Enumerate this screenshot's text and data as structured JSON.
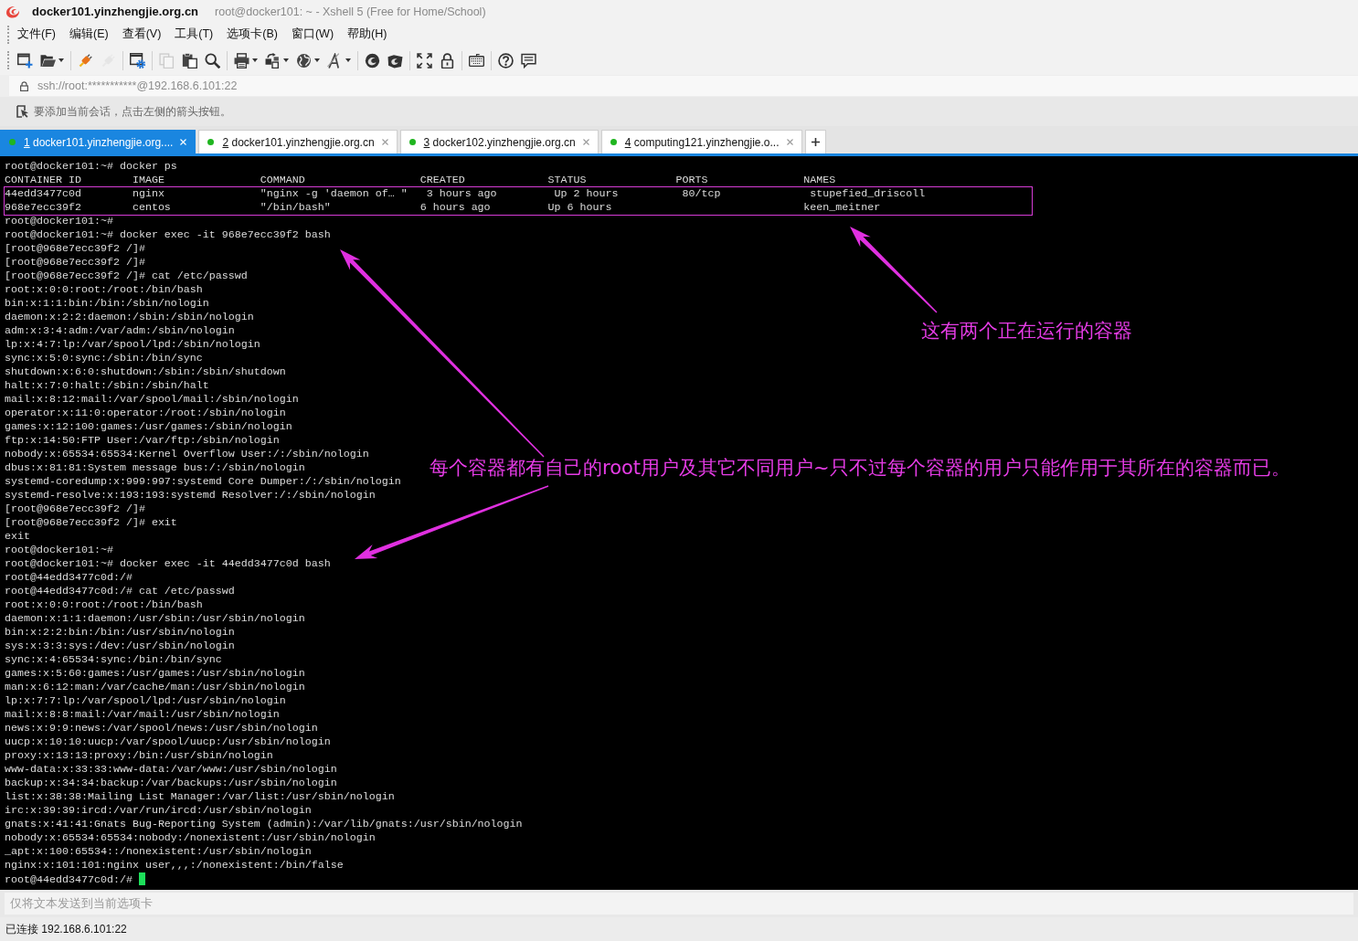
{
  "window": {
    "title": "docker101.yinzhengjie.org.cn",
    "subtitle": "root@docker101: ~ - Xshell 5 (Free for Home/School)"
  },
  "menu": [
    "文件(F)",
    "编辑(E)",
    "查看(V)",
    "工具(T)",
    "选项卡(B)",
    "窗口(W)",
    "帮助(H)"
  ],
  "toolbar": {
    "groups": [
      {
        "buttons": [
          {
            "disabled": false,
            "dropdown": false
          },
          {
            "disabled": false,
            "dropdown": true
          }
        ]
      },
      {
        "buttons": [
          {
            "disabled": false,
            "dropdown": false
          },
          {
            "disabled": true,
            "dropdown": false
          }
        ]
      },
      {
        "buttons": [
          {
            "disabled": false,
            "dropdown": false
          }
        ]
      },
      {
        "buttons": [
          {
            "disabled": true,
            "dropdown": false
          },
          {
            "disabled": false,
            "dropdown": false
          },
          {
            "disabled": false,
            "dropdown": false
          }
        ]
      },
      {
        "buttons": [
          {
            "disabled": false,
            "dropdown": true
          },
          {
            "disabled": false,
            "dropdown": true
          },
          {
            "disabled": false,
            "dropdown": true
          },
          {
            "disabled": false,
            "dropdown": true
          }
        ]
      },
      {
        "buttons": [
          {
            "disabled": false,
            "dropdown": false
          },
          {
            "disabled": false,
            "dropdown": false
          }
        ]
      },
      {
        "buttons": [
          {
            "disabled": false,
            "dropdown": false
          },
          {
            "disabled": false,
            "dropdown": false
          }
        ]
      },
      {
        "buttons": [
          {
            "disabled": false,
            "dropdown": false
          }
        ]
      },
      {
        "buttons": [
          {
            "disabled": false,
            "dropdown": false
          },
          {
            "disabled": false,
            "dropdown": false
          }
        ]
      }
    ]
  },
  "address_bar": {
    "value": "ssh://root:***********@192.168.6.101:22"
  },
  "hint": "要添加当前会话，点击左侧的箭头按钮。",
  "tabs": [
    {
      "number": "1",
      "label": "docker101.yinzhengjie.org....",
      "selected": true,
      "connected": true
    },
    {
      "number": "2",
      "label": "docker101.yinzhengjie.org.cn",
      "selected": false,
      "connected": true
    },
    {
      "number": "3",
      "label": "docker102.yinzhengjie.org.cn",
      "selected": false,
      "connected": true
    },
    {
      "number": "4",
      "label": "computing121.yinzhengjie.o...",
      "selected": false,
      "connected": true
    }
  ],
  "terminal": {
    "blocks": [
      {
        "kind": "text",
        "lines": [
          "root@docker101:~# docker ps",
          "CONTAINER ID        IMAGE               COMMAND                  CREATED             STATUS              PORTS               NAMES"
        ]
      },
      {
        "kind": "boxed",
        "lines": [
          "44edd3477c0d        nginx               \"nginx -g 'daemon of… \"   3 hours ago         Up 2 hours          80/tcp              stupefied_driscoll",
          "968e7ecc39f2        centos              \"/bin/bash\"              6 hours ago         Up 6 hours                              keen_meitner"
        ]
      },
      {
        "kind": "text",
        "lines": [
          "root@docker101:~#",
          "root@docker101:~# docker exec -it 968e7ecc39f2 bash",
          "[root@968e7ecc39f2 /]#",
          "[root@968e7ecc39f2 /]#",
          "[root@968e7ecc39f2 /]# cat /etc/passwd",
          "root:x:0:0:root:/root:/bin/bash",
          "bin:x:1:1:bin:/bin:/sbin/nologin",
          "daemon:x:2:2:daemon:/sbin:/sbin/nologin",
          "adm:x:3:4:adm:/var/adm:/sbin/nologin",
          "lp:x:4:7:lp:/var/spool/lpd:/sbin/nologin",
          "sync:x:5:0:sync:/sbin:/bin/sync",
          "shutdown:x:6:0:shutdown:/sbin:/sbin/shutdown",
          "halt:x:7:0:halt:/sbin:/sbin/halt",
          "mail:x:8:12:mail:/var/spool/mail:/sbin/nologin",
          "operator:x:11:0:operator:/root:/sbin/nologin",
          "games:x:12:100:games:/usr/games:/sbin/nologin",
          "ftp:x:14:50:FTP User:/var/ftp:/sbin/nologin",
          "nobody:x:65534:65534:Kernel Overflow User:/:/sbin/nologin",
          "dbus:x:81:81:System message bus:/:/sbin/nologin",
          "systemd-coredump:x:999:997:systemd Core Dumper:/:/sbin/nologin",
          "systemd-resolve:x:193:193:systemd Resolver:/:/sbin/nologin",
          "[root@968e7ecc39f2 /]#",
          "[root@968e7ecc39f2 /]# exit",
          "exit",
          "root@docker101:~#",
          "root@docker101:~# docker exec -it 44edd3477c0d bash",
          "root@44edd3477c0d:/#",
          "root@44edd3477c0d:/# cat /etc/passwd",
          "root:x:0:0:root:/root:/bin/bash",
          "daemon:x:1:1:daemon:/usr/sbin:/usr/sbin/nologin",
          "bin:x:2:2:bin:/bin:/usr/sbin/nologin",
          "sys:x:3:3:sys:/dev:/usr/sbin/nologin",
          "sync:x:4:65534:sync:/bin:/bin/sync",
          "games:x:5:60:games:/usr/games:/usr/sbin/nologin",
          "man:x:6:12:man:/var/cache/man:/usr/sbin/nologin",
          "lp:x:7:7:lp:/var/spool/lpd:/usr/sbin/nologin",
          "mail:x:8:8:mail:/var/mail:/usr/sbin/nologin",
          "news:x:9:9:news:/var/spool/news:/usr/sbin/nologin",
          "uucp:x:10:10:uucp:/var/spool/uucp:/usr/sbin/nologin",
          "proxy:x:13:13:proxy:/bin:/usr/sbin/nologin",
          "www-data:x:33:33:www-data:/var/www:/usr/sbin/nologin",
          "backup:x:34:34:backup:/var/backups:/usr/sbin/nologin",
          "list:x:38:38:Mailing List Manager:/var/list:/usr/sbin/nologin",
          "irc:x:39:39:ircd:/var/run/ircd:/usr/sbin/nologin",
          "gnats:x:41:41:Gnats Bug-Reporting System (admin):/var/lib/gnats:/usr/sbin/nologin",
          "nobody:x:65534:65534:nobody:/nonexistent:/usr/sbin/nologin",
          "_apt:x:100:65534::/nonexistent:/usr/sbin/nologin",
          "nginx:x:101:101:nginx user,,,:/nonexistent:/bin/false",
          "root@44edd3477c0d:/#"
        ]
      }
    ],
    "cursor": true
  },
  "annotations": [
    {
      "text": "这有两个正在运行的容器"
    },
    {
      "text": "每个容器都有自己的root用户及其它不同用户~只不过每个容器的用户只能作用于其所在的容器而已。"
    }
  ],
  "compose_bar": {
    "placeholder": "仅将文本发送到当前选项卡"
  },
  "status_bar": "已连接 192.168.6.101:22"
}
